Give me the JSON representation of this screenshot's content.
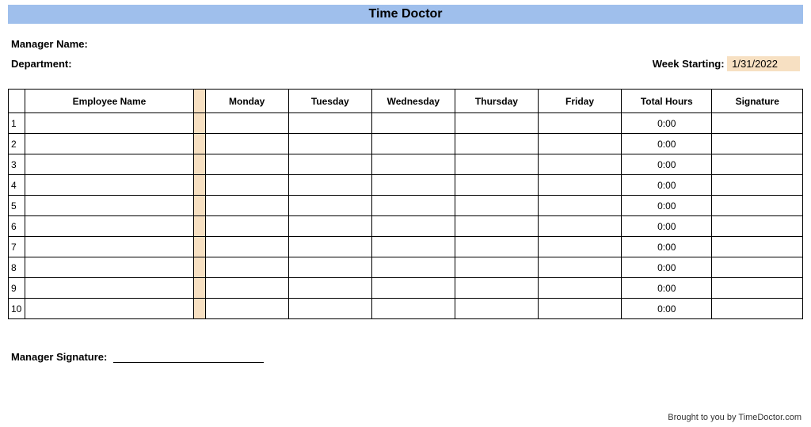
{
  "title": "Time Doctor",
  "labels": {
    "manager_name": "Manager Name:",
    "department": "Department:",
    "week_starting": "Week Starting:",
    "manager_signature": "Manager Signature:"
  },
  "week_starting_value": "1/31/2022",
  "columns": {
    "index": "",
    "employee_name": "Employee Name",
    "sep": "",
    "monday": "Monday",
    "tuesday": "Tuesday",
    "wednesday": "Wednesday",
    "thursday": "Thursday",
    "friday": "Friday",
    "total_hours": "Total Hours",
    "signature": "Signature"
  },
  "rows": [
    {
      "n": "1",
      "name": "",
      "mon": "",
      "tue": "",
      "wed": "",
      "thu": "",
      "fri": "",
      "total": "0:00",
      "sig": ""
    },
    {
      "n": "2",
      "name": "",
      "mon": "",
      "tue": "",
      "wed": "",
      "thu": "",
      "fri": "",
      "total": "0:00",
      "sig": ""
    },
    {
      "n": "3",
      "name": "",
      "mon": "",
      "tue": "",
      "wed": "",
      "thu": "",
      "fri": "",
      "total": "0:00",
      "sig": ""
    },
    {
      "n": "4",
      "name": "",
      "mon": "",
      "tue": "",
      "wed": "",
      "thu": "",
      "fri": "",
      "total": "0:00",
      "sig": ""
    },
    {
      "n": "5",
      "name": "",
      "mon": "",
      "tue": "",
      "wed": "",
      "thu": "",
      "fri": "",
      "total": "0:00",
      "sig": ""
    },
    {
      "n": "6",
      "name": "",
      "mon": "",
      "tue": "",
      "wed": "",
      "thu": "",
      "fri": "",
      "total": "0:00",
      "sig": ""
    },
    {
      "n": "7",
      "name": "",
      "mon": "",
      "tue": "",
      "wed": "",
      "thu": "",
      "fri": "",
      "total": "0:00",
      "sig": ""
    },
    {
      "n": "8",
      "name": "",
      "mon": "",
      "tue": "",
      "wed": "",
      "thu": "",
      "fri": "",
      "total": "0:00",
      "sig": ""
    },
    {
      "n": "9",
      "name": "",
      "mon": "",
      "tue": "",
      "wed": "",
      "thu": "",
      "fri": "",
      "total": "0:00",
      "sig": ""
    },
    {
      "n": "10",
      "name": "",
      "mon": "",
      "tue": "",
      "wed": "",
      "thu": "",
      "fri": "",
      "total": "0:00",
      "sig": ""
    }
  ],
  "footer": "Brought to you by TimeDoctor.com"
}
